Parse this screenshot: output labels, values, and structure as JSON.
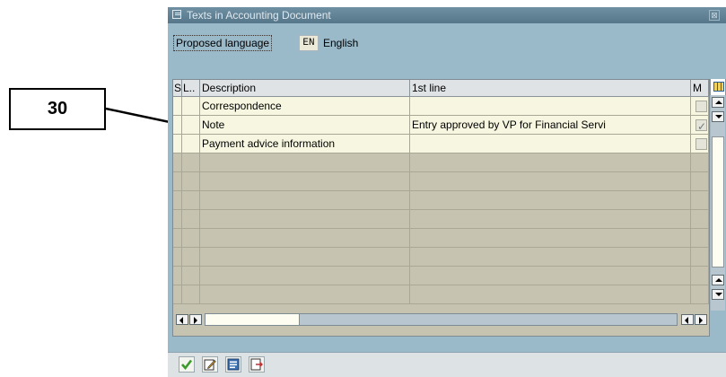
{
  "callout": {
    "label": "30"
  },
  "dialog": {
    "title": "Texts in Accounting Document",
    "close_glyph": "⊠"
  },
  "language": {
    "label": "Proposed language",
    "code": "EN",
    "name": "English"
  },
  "table": {
    "columns": {
      "s": "S",
      "l": "L..",
      "description": "Description",
      "first_line": "1st line",
      "m": "M"
    },
    "rows": [
      {
        "description": "Correspondence",
        "first_line": "",
        "m_checked": false
      },
      {
        "description": "Note",
        "first_line": "Entry approved by VP for Financial Servi",
        "m_checked": true
      },
      {
        "description": "Payment advice information",
        "first_line": "",
        "m_checked": false
      }
    ],
    "empty_rows": 8
  },
  "footer": {
    "buttons": [
      "checkmark-icon",
      "edit-icon",
      "details-icon",
      "exit-icon"
    ]
  },
  "colors": {
    "dialog_bg": "#9ab9c9",
    "row_filled": "#f7f7e1",
    "row_empty": "#c6c4b1",
    "check_green": "#3a9a2a"
  }
}
